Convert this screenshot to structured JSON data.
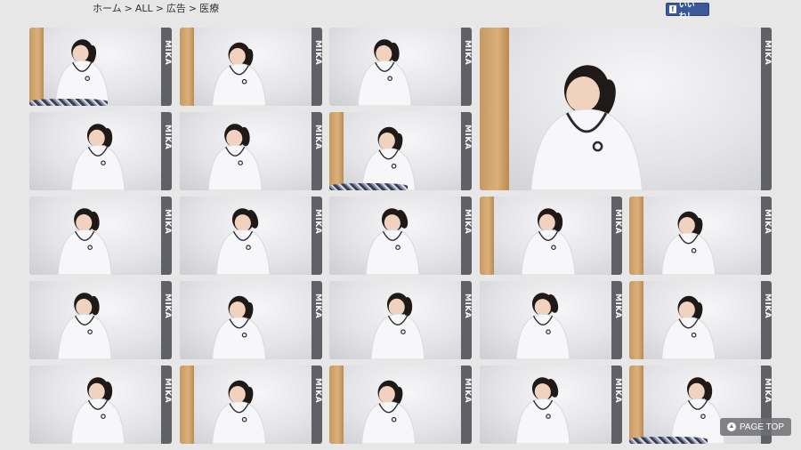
{
  "breadcrumb": {
    "items": [
      "ホーム",
      "ALL",
      "広告",
      "医療"
    ],
    "separator": ">"
  },
  "facebook": {
    "like_label": "いいね！",
    "icon": "facebook-f-icon"
  },
  "page_top": {
    "label": "PAGE TOP",
    "icon": "chevron-up-icon"
  },
  "tiles": [
    {
      "brand": "MIKA",
      "wood": true,
      "blanket": true,
      "pose": "sit-low"
    },
    {
      "brand": "MIKA",
      "wood": true,
      "blanket": false,
      "pose": "down"
    },
    {
      "brand": "MIKA",
      "wood": false,
      "blanket": false,
      "pose": "side"
    },
    {
      "brand": "MIKA",
      "wood": true,
      "blanket": false,
      "pose": "large-down"
    },
    {
      "brand": "MIKA",
      "wood": false,
      "blanket": false,
      "pose": "smile"
    },
    {
      "brand": "MIKA",
      "wood": false,
      "blanket": false,
      "pose": "side"
    },
    {
      "brand": "MIKA",
      "wood": true,
      "blanket": true,
      "pose": "down"
    },
    {
      "brand": "MIKA",
      "wood": false,
      "blanket": false,
      "pose": "side"
    },
    {
      "brand": "MIKA",
      "wood": false,
      "blanket": false,
      "pose": "tilt"
    },
    {
      "brand": "MIKA",
      "wood": false,
      "blanket": false,
      "pose": "tilt"
    },
    {
      "brand": "MIKA",
      "wood": true,
      "blanket": false,
      "pose": "smile"
    },
    {
      "brand": "MIKA",
      "wood": true,
      "blanket": false,
      "pose": "down"
    },
    {
      "brand": "MIKA",
      "wood": false,
      "blanket": false,
      "pose": "side"
    },
    {
      "brand": "MIKA",
      "wood": false,
      "blanket": false,
      "pose": "down"
    },
    {
      "brand": "MIKA",
      "wood": false,
      "blanket": false,
      "pose": "smile"
    },
    {
      "brand": "MIKA",
      "wood": false,
      "blanket": false,
      "pose": "tilt"
    },
    {
      "brand": "MIKA",
      "wood": true,
      "blanket": false,
      "pose": "down"
    },
    {
      "brand": "MIKA",
      "wood": false,
      "blanket": false,
      "pose": "smile"
    },
    {
      "brand": "MIKA",
      "wood": true,
      "blanket": false,
      "pose": "down"
    },
    {
      "brand": "MIKA",
      "wood": true,
      "blanket": false,
      "pose": "down"
    },
    {
      "brand": "MIKA",
      "wood": false,
      "blanket": false,
      "pose": "tilt"
    },
    {
      "brand": "MIKA",
      "wood": true,
      "blanket": true,
      "pose": "smile"
    }
  ],
  "colors": {
    "background": "#e7e7e7",
    "brand_strip": "#5f6166",
    "facebook_blue": "#3b5998"
  }
}
